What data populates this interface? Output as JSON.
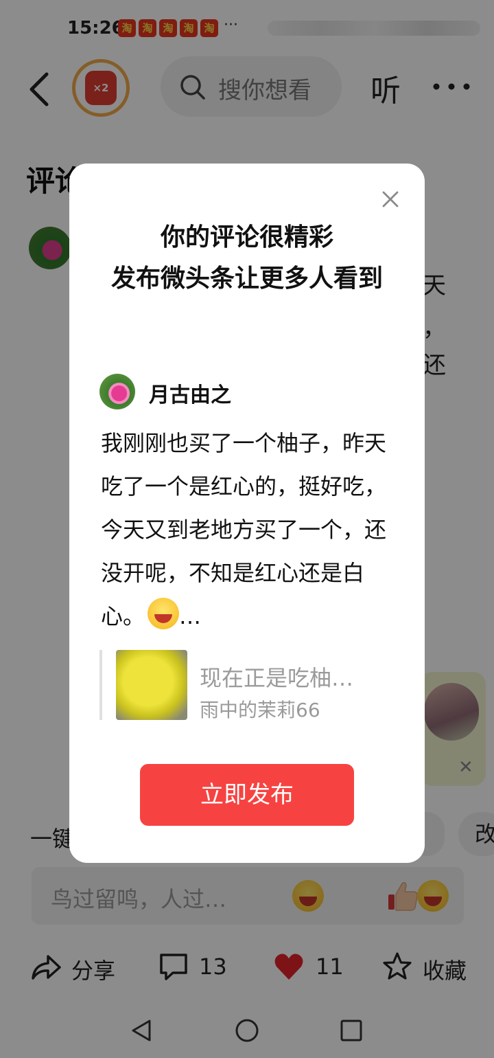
{
  "status_bar": {
    "time": "15:26",
    "notification_icons": [
      "淘",
      "淘",
      "淘",
      "淘",
      "淘"
    ],
    "overflow": "···"
  },
  "top_nav": {
    "redpack_badge": "×2",
    "search_placeholder": "搜你想看",
    "listen_label": "听"
  },
  "background": {
    "section_title_fragment": "评论",
    "text_fragments": [
      "天",
      "，",
      "还"
    ],
    "one_tap_fragment": "一键",
    "edit_fragment": "改",
    "comment_placeholder": "鸟过留鸣，人过…",
    "actions": {
      "share_label": "分享",
      "comment_count": "13",
      "like_count": "11",
      "favorite_label": "收藏"
    },
    "colors": {
      "like_heart": "#e3242b"
    }
  },
  "dialog": {
    "title": "你的评论很精彩\n发布微头条让更多人看到",
    "author_name": "月古由之",
    "comment_text": "我刚刚也买了一个柚子，昨天吃了一个是红心的，挺好吃，今天又到老地方买了一个，还没开呢，不知是红心还是白心。",
    "ellipsis": "…",
    "quote": {
      "title": "现在正是吃柚…",
      "source": "雨中的茉莉66"
    },
    "publish_label": "立即发布",
    "colors": {
      "publish_button": "#f64341"
    }
  }
}
